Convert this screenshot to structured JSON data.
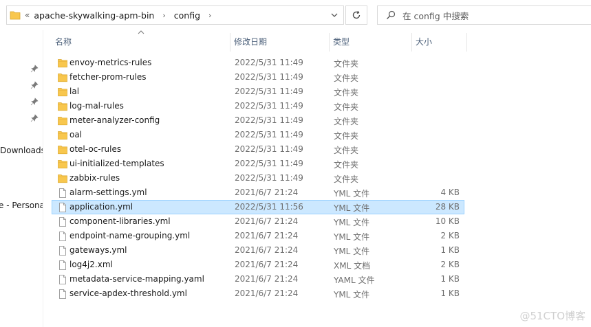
{
  "address_bar": {
    "overflow_glyph": "«",
    "crumbs": [
      "apache-skywalking-apm-bin",
      "config"
    ]
  },
  "search": {
    "placeholder": "在 config 中搜索"
  },
  "nav": {
    "labels": [
      "Downloads",
      "e - Persona"
    ]
  },
  "columns": {
    "name": "名称",
    "modified": "修改日期",
    "type": "类型",
    "size": "大小"
  },
  "files": [
    {
      "name": "envoy-metrics-rules",
      "date": "2022/5/31 11:49",
      "type": "文件夹",
      "size": "",
      "kind": "folder"
    },
    {
      "name": "fetcher-prom-rules",
      "date": "2022/5/31 11:49",
      "type": "文件夹",
      "size": "",
      "kind": "folder"
    },
    {
      "name": "lal",
      "date": "2022/5/31 11:49",
      "type": "文件夹",
      "size": "",
      "kind": "folder"
    },
    {
      "name": "log-mal-rules",
      "date": "2022/5/31 11:49",
      "type": "文件夹",
      "size": "",
      "kind": "folder"
    },
    {
      "name": "meter-analyzer-config",
      "date": "2022/5/31 11:49",
      "type": "文件夹",
      "size": "",
      "kind": "folder"
    },
    {
      "name": "oal",
      "date": "2022/5/31 11:49",
      "type": "文件夹",
      "size": "",
      "kind": "folder"
    },
    {
      "name": "otel-oc-rules",
      "date": "2022/5/31 11:49",
      "type": "文件夹",
      "size": "",
      "kind": "folder"
    },
    {
      "name": "ui-initialized-templates",
      "date": "2022/5/31 11:49",
      "type": "文件夹",
      "size": "",
      "kind": "folder"
    },
    {
      "name": "zabbix-rules",
      "date": "2022/5/31 11:49",
      "type": "文件夹",
      "size": "",
      "kind": "folder"
    },
    {
      "name": "alarm-settings.yml",
      "date": "2021/6/7 21:24",
      "type": "YML 文件",
      "size": "4 KB",
      "kind": "file"
    },
    {
      "name": "application.yml",
      "date": "2022/5/31 11:56",
      "type": "YML 文件",
      "size": "28 KB",
      "kind": "file",
      "selected": true
    },
    {
      "name": "component-libraries.yml",
      "date": "2021/6/7 21:24",
      "type": "YML 文件",
      "size": "10 KB",
      "kind": "file"
    },
    {
      "name": "endpoint-name-grouping.yml",
      "date": "2021/6/7 21:24",
      "type": "YML 文件",
      "size": "2 KB",
      "kind": "file"
    },
    {
      "name": "gateways.yml",
      "date": "2021/6/7 21:24",
      "type": "YML 文件",
      "size": "1 KB",
      "kind": "file"
    },
    {
      "name": "log4j2.xml",
      "date": "2021/6/7 21:24",
      "type": "XML 文档",
      "size": "2 KB",
      "kind": "file"
    },
    {
      "name": "metadata-service-mapping.yaml",
      "date": "2021/6/7 21:24",
      "type": "YAML 文件",
      "size": "1 KB",
      "kind": "file"
    },
    {
      "name": "service-apdex-threshold.yml",
      "date": "2021/6/7 21:24",
      "type": "YML 文件",
      "size": "1 KB",
      "kind": "file"
    }
  ],
  "watermark": "@51CTO博客",
  "colors": {
    "folder": "#f8c74e",
    "selection_bg": "#cce8ff",
    "selection_border": "#99d1ff",
    "header_text": "#4c607a"
  }
}
